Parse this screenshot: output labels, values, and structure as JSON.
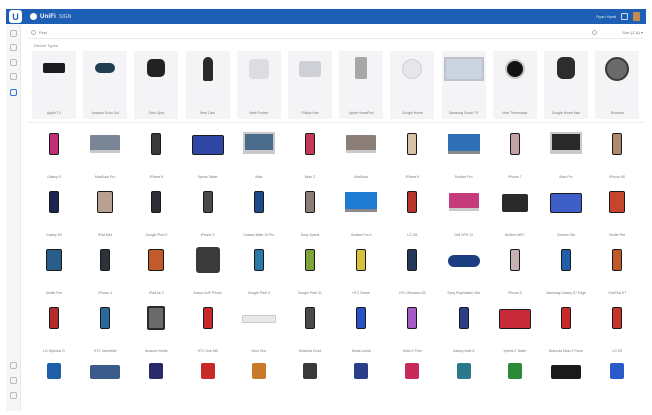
{
  "app": {
    "logo_letter": "U",
    "brand_name": "UniFi",
    "brand_sub": "SIGN",
    "user_label": "Ryan Hyatt"
  },
  "search": {
    "placeholder": "Find"
  },
  "sort": {
    "label": "Sort (Z-A) ▾"
  },
  "section": {
    "label": "Device Types"
  },
  "strip_items": [
    {
      "label": "Apple TV",
      "kind": "appletv",
      "color": "#1c1c1e"
    },
    {
      "label": "Amazon Echo Dot",
      "kind": "echodot",
      "color": "#1f3e52"
    },
    {
      "label": "Echo Spot",
      "kind": "echospot",
      "color": "#222222"
    },
    {
      "label": "Nest Cam",
      "kind": "nestcam",
      "color": "#2a2a2a"
    },
    {
      "label": "Nest Protect",
      "kind": "nestprotect",
      "color": "#dcdde0"
    },
    {
      "label": "Philips Hue",
      "kind": "hue",
      "color": "#cfcfd6"
    },
    {
      "label": "Apple HomePod",
      "kind": "speaker",
      "color": "#a7a7a7"
    },
    {
      "label": "Google Home",
      "kind": "googlehome",
      "color": "#e6e7ea"
    },
    {
      "label": "Samsung Smart TV",
      "kind": "tv",
      "color": "#c9d4e0"
    },
    {
      "label": "Nest Thermostat",
      "kind": "thermostat",
      "color": "#121212"
    },
    {
      "label": "Google Home Max",
      "kind": "homepod",
      "color": "#2d2d2d"
    },
    {
      "label": "Roomba",
      "kind": "roomba",
      "color": "#6a6a6a"
    }
  ],
  "grid_rows": [
    [
      {
        "label": "Galaxy S",
        "kind": "phone",
        "color": "#c0307a"
      },
      {
        "label": "MacBook Pro",
        "kind": "laptop",
        "color": "#7a8696"
      },
      {
        "label": "iPhone 8",
        "kind": "phone",
        "color": "#3a3a3c"
      },
      {
        "label": "Xperia Tablet",
        "kind": "tabletwide",
        "color": "#3046a6"
      },
      {
        "label": "iMac",
        "kind": "imac",
        "color": "#4a6b8a"
      },
      {
        "label": "Moto Z",
        "kind": "phone",
        "color": "#c23a55"
      },
      {
        "label": "MacBook",
        "kind": "laptop",
        "color": "#8a7e76"
      },
      {
        "label": "iPhone 6",
        "kind": "phone",
        "color": "#d6c3a7"
      },
      {
        "label": "Surface Pro",
        "kind": "laptopwin",
        "color": "#2e6fb5"
      },
      {
        "label": "iPhone 7",
        "kind": "phone",
        "color": "#c2a2a6"
      },
      {
        "label": "iMac Pro",
        "kind": "imac",
        "color": "#2a2a2a"
      },
      {
        "label": "iPhone 6S",
        "kind": "phone",
        "color": "#b08a6c"
      }
    ],
    [
      {
        "label": "Galaxy S9",
        "kind": "phone",
        "color": "#1b2554"
      },
      {
        "label": "iPad Mini",
        "kind": "tablet",
        "color": "#b8a190"
      },
      {
        "label": "Google Pixel 2",
        "kind": "phone",
        "color": "#2f3037"
      },
      {
        "label": "iPhone X",
        "kind": "phone",
        "color": "#4a4a4c"
      },
      {
        "label": "Huawei Mate 10 Pro",
        "kind": "phone",
        "color": "#1e4a8a"
      },
      {
        "label": "Sony Xperia",
        "kind": "phone",
        "color": "#8a7d78"
      },
      {
        "label": "Surface Pro 4",
        "kind": "laptopwin",
        "color": "#1d7bd1"
      },
      {
        "label": "LG G6",
        "kind": "phone",
        "color": "#b8352e"
      },
      {
        "label": "Dell XPS 13",
        "kind": "laptop",
        "color": "#c43a7a"
      },
      {
        "label": "Brother MFC",
        "kind": "printer",
        "color": "#2a2a2a"
      },
      {
        "label": "Chrome Tab",
        "kind": "tabletwide",
        "color": "#3e5ec8"
      },
      {
        "label": "Kindle Fire",
        "kind": "tablet",
        "color": "#c7452c"
      }
    ],
    [
      {
        "label": "Kindle Fire",
        "kind": "tablet",
        "color": "#2a5e8a"
      },
      {
        "label": "iPhone 4",
        "kind": "phone",
        "color": "#2d3238"
      },
      {
        "label": "iPad Air 2",
        "kind": "tablet",
        "color": "#c25a2c"
      },
      {
        "label": "Avaya VoIP Phone",
        "kind": "deskphone",
        "color": "#3a3a3a"
      },
      {
        "label": "Google Pixel 3",
        "kind": "phone",
        "color": "#2a7aa8"
      },
      {
        "label": "Google Pixel XL",
        "kind": "phone",
        "color": "#7aa63a"
      },
      {
        "label": "HTC Desire",
        "kind": "phone",
        "color": "#d9c23a"
      },
      {
        "label": "HTC Windows 8X",
        "kind": "phone",
        "color": "#24365a"
      },
      {
        "label": "Sony PlayStation Vita",
        "kind": "psvita",
        "color": "#1c3d80"
      },
      {
        "label": "iPhone 5",
        "kind": "phone",
        "color": "#c6b0b2"
      },
      {
        "label": "Samsung Galaxy S7 Edge",
        "kind": "phone",
        "color": "#1f5fa8"
      },
      {
        "label": "OnePlus 5T",
        "kind": "phone",
        "color": "#c05a2a"
      }
    ],
    [
      {
        "label": "LG Optimus G",
        "kind": "phone",
        "color": "#b52a2a"
      },
      {
        "label": "HTC Incredible",
        "kind": "phone",
        "color": "#2a6a9a"
      },
      {
        "label": "Amazon Kindle",
        "kind": "kindle",
        "color": "#6a6a6a"
      },
      {
        "label": "HTC One M8",
        "kind": "phone",
        "color": "#c82a2a"
      },
      {
        "label": "Xbox One",
        "kind": "xbox",
        "color": "#e8e8e8"
      },
      {
        "label": "Motorola Droid",
        "kind": "phone",
        "color": "#4a4a4a"
      },
      {
        "label": "Nokia Lumia",
        "kind": "phone",
        "color": "#2a52c8"
      },
      {
        "label": "Moto X Pure",
        "kind": "phone",
        "color": "#a65ac8"
      },
      {
        "label": "Galaxy Note 8",
        "kind": "phone",
        "color": "#2a3e8a"
      },
      {
        "label": "Xperia Z Tablet",
        "kind": "tabletwide",
        "color": "#c82a3a"
      },
      {
        "label": "Motorola Moto Z Force",
        "kind": "phone",
        "color": "#c82a2a"
      },
      {
        "label": "LG G5",
        "kind": "phone",
        "color": "#c8342a"
      }
    ],
    [
      {
        "label": "",
        "kind": "partial",
        "color": "#1f5fa8"
      },
      {
        "label": "",
        "kind": "partialwide",
        "color": "#3a5a8a"
      },
      {
        "label": "",
        "kind": "partial",
        "color": "#2a2a6a"
      },
      {
        "label": "",
        "kind": "partial",
        "color": "#c82a2a"
      },
      {
        "label": "",
        "kind": "partial",
        "color": "#c87a2a"
      },
      {
        "label": "",
        "kind": "partial",
        "color": "#3a3a3a"
      },
      {
        "label": "",
        "kind": "partial",
        "color": "#2a3e8a"
      },
      {
        "label": "",
        "kind": "partial",
        "color": "#c82a5a"
      },
      {
        "label": "",
        "kind": "partial",
        "color": "#2a7a8a"
      },
      {
        "label": "",
        "kind": "partial",
        "color": "#2a8a3a"
      },
      {
        "label": "",
        "kind": "partialwide",
        "color": "#1a1a1a"
      },
      {
        "label": "",
        "kind": "partial",
        "color": "#2a5ac8"
      }
    ]
  ]
}
